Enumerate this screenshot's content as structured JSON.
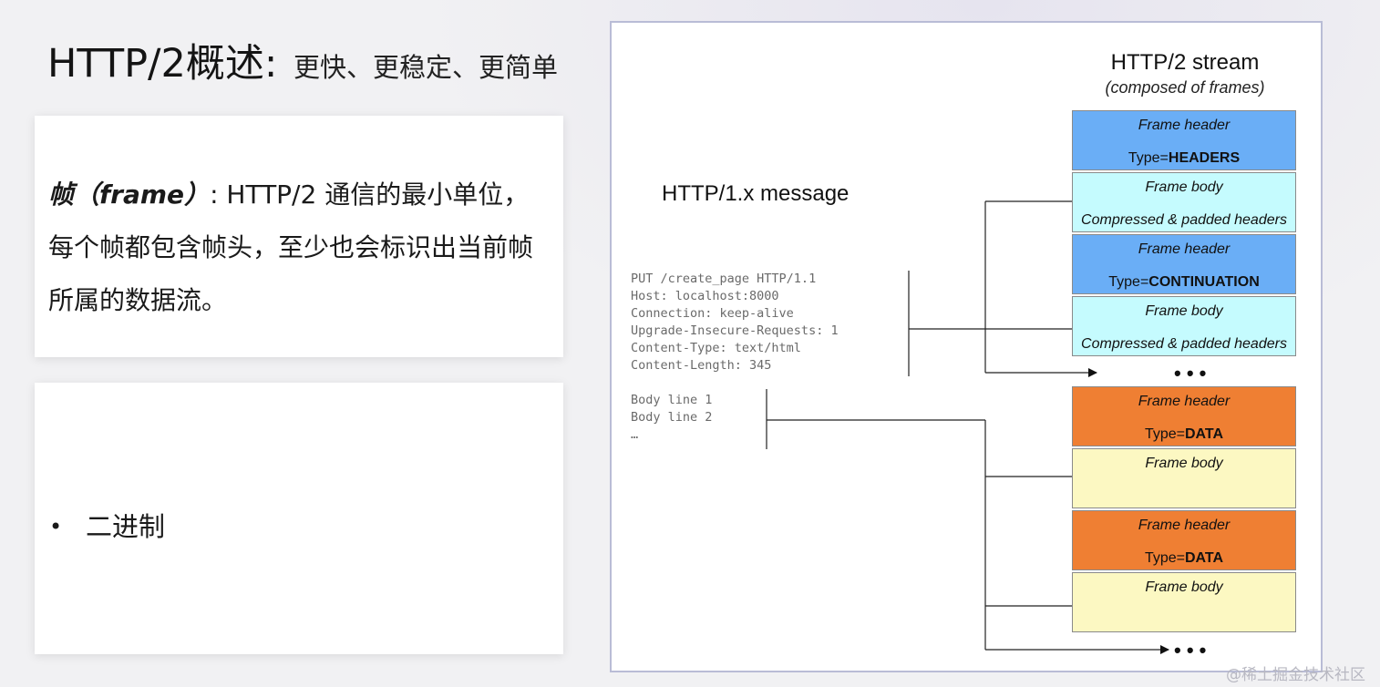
{
  "slide": {
    "title_main": "HTTP/2概述",
    "title_sep": ": ",
    "title_sub": "更快、更稳定、更简单"
  },
  "card1": {
    "term": "帧（frame）",
    "text": ": HTTP/2 通信的最小单位，每个帧都包含帧头，至少也会标识出当前帧所属的数据流。"
  },
  "card2": {
    "bullet": "•",
    "item": "二进制"
  },
  "diagram": {
    "stream_title": "HTTP/2 stream",
    "stream_subtitle": "(composed of frames)",
    "message_title": "HTTP/1.x message",
    "header_lines": [
      "PUT /create_page HTTP/1.1",
      "Host: localhost:8000",
      "Connection: keep-alive",
      "Upgrade-Insecure-Requests: 1",
      "Content-Type: text/html",
      "Content-Length: 345"
    ],
    "body_lines": [
      "Body line 1",
      "Body line 2",
      "…"
    ],
    "frames": [
      {
        "line1": "Frame header",
        "prefix": "Type=",
        "bold": "HEADERS"
      },
      {
        "line1": "Frame body",
        "italic": "Compressed & padded headers"
      },
      {
        "line1": "Frame header",
        "prefix": "Type=",
        "bold": "CONTINUATION"
      },
      {
        "line1": "Frame body",
        "italic": "Compressed & padded headers"
      },
      {
        "line1": "Frame header",
        "prefix": "Type=",
        "bold": "DATA"
      },
      {
        "line1": "Frame body"
      },
      {
        "line1": "Frame header",
        "prefix": "Type=",
        "bold": "DATA"
      },
      {
        "line1": "Frame body"
      }
    ],
    "ellipsis_1": "• • •",
    "ellipsis_2": "• • •",
    "colors": {
      "headers_frame": "#6aaef6",
      "header_body": "#c5fbfe",
      "data_frame": "#ef7f33",
      "data_body": "#fcf8c2"
    }
  },
  "watermark": "@稀土掘金技术社区"
}
